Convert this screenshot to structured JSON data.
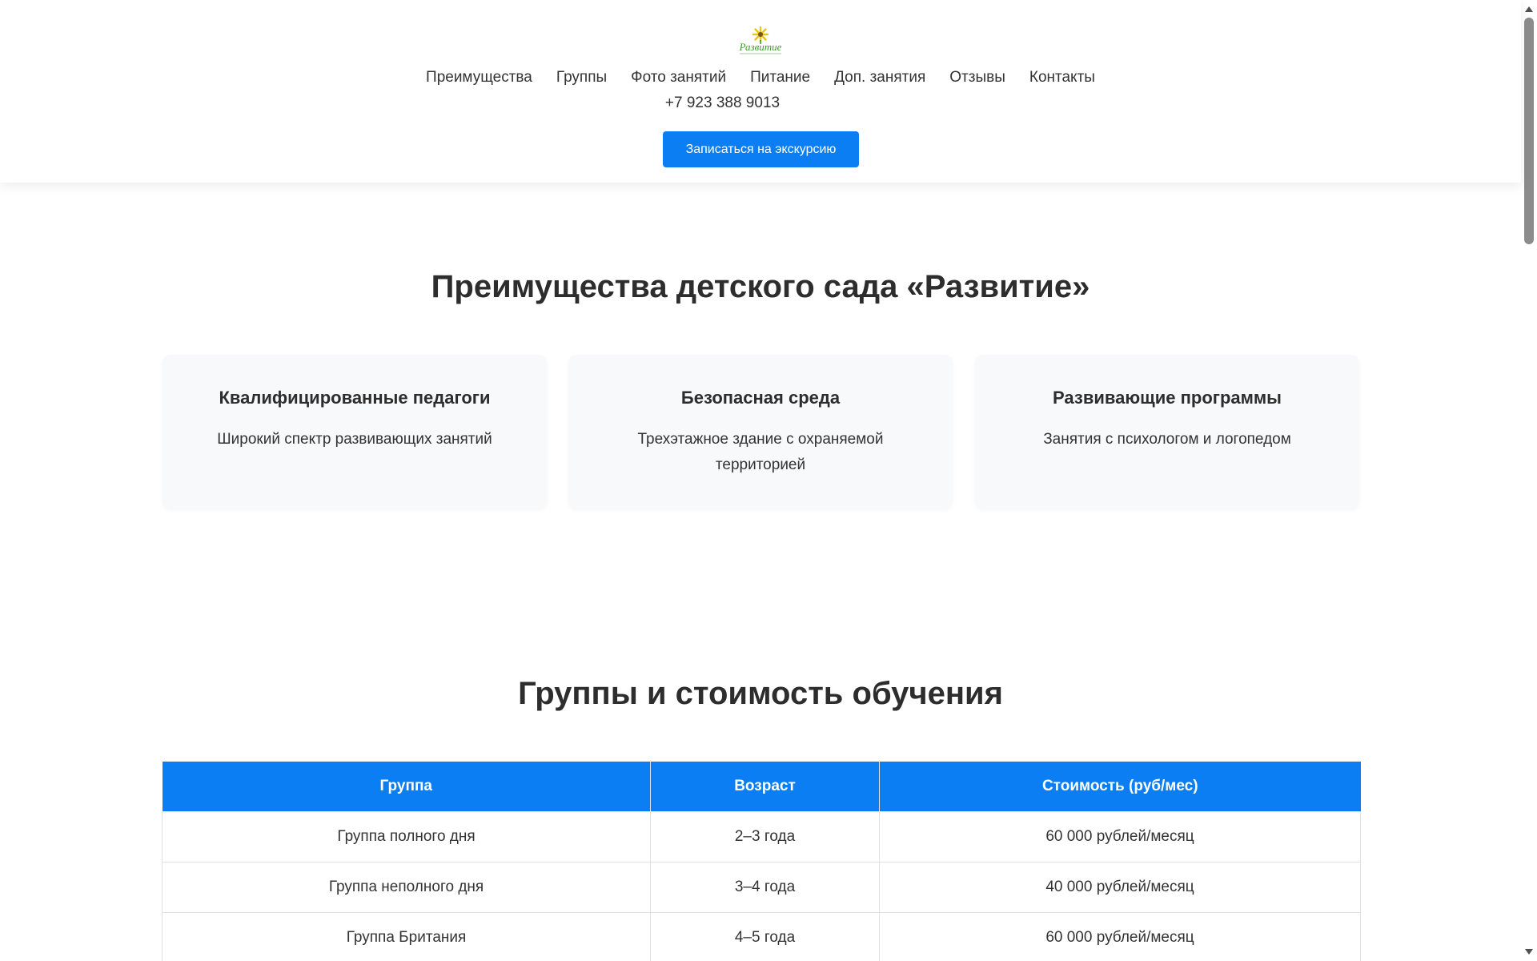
{
  "header": {
    "logo_text": "Развитие",
    "nav": [
      "Преимущества",
      "Группы",
      "Фото занятий",
      "Питание",
      "Доп. занятия",
      "Отзывы",
      "Контакты"
    ],
    "phone": "+7 923 388 9013",
    "cta_label": "Записаться на экскурсию"
  },
  "advantages": {
    "title": "Преимущества детского сада «Развитие»",
    "cards": [
      {
        "title": "Квалифицированные педагоги",
        "text": "Широкий спектр развивающих занятий"
      },
      {
        "title": "Безопасная среда",
        "text": "Трехэтажное здание с охраняемой территорией"
      },
      {
        "title": "Развивающие программы",
        "text": "Занятия с психологом и логопедом"
      }
    ]
  },
  "groups": {
    "title": "Группы и стоимость обучения",
    "columns": [
      "Группа",
      "Возраст",
      "Стоимость (руб/мес)"
    ],
    "rows": [
      [
        "Группа полного дня",
        "2–3 года",
        "60 000 рублей/месяц"
      ],
      [
        "Группа неполного дня",
        "3–4 года",
        "40 000 рублей/месяц"
      ],
      [
        "Группа Британия",
        "4–5 года",
        "60 000 рублей/месяц"
      ]
    ]
  },
  "colors": {
    "accent": "#0b7ef4",
    "card_bg": "#f8f9fa",
    "logo_flower": "#e6c619",
    "logo_text": "#3a9a2a"
  }
}
